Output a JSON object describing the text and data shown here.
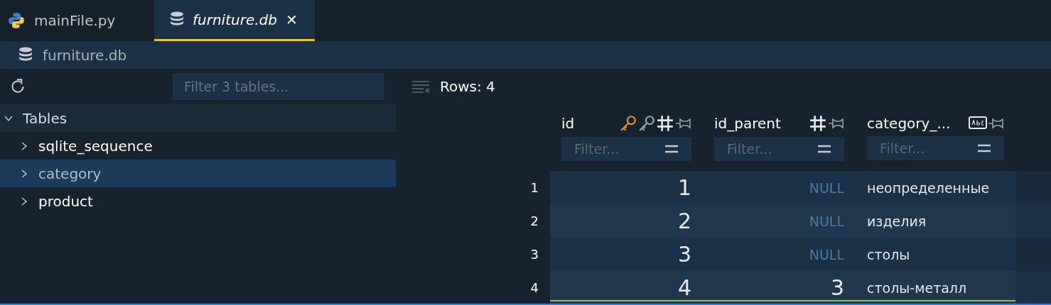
{
  "tabs": [
    {
      "label": "mainFile.py",
      "kind": "python",
      "selected": false,
      "italic": false,
      "closable": false
    },
    {
      "label": "furniture.db",
      "kind": "database",
      "selected": true,
      "italic": true,
      "closable": true
    }
  ],
  "close_glyph": "✕",
  "breadcrumb": "furniture.db",
  "sidebar": {
    "filter_placeholder": "Filter 3 tables...",
    "tree": [
      {
        "label": "Tables",
        "expanded": true,
        "selected": false,
        "children": [
          {
            "label": "sqlite_sequence",
            "expanded": false,
            "selected": false
          },
          {
            "label": "category",
            "expanded": false,
            "selected": true
          },
          {
            "label": "product",
            "expanded": false,
            "selected": false
          }
        ]
      }
    ]
  },
  "grid": {
    "row_count": "Rows: 4",
    "columns": [
      {
        "name": "id",
        "primary_key": true,
        "foreign_key": true,
        "kind": "integer",
        "filter_placeholder": "Filter..."
      },
      {
        "name": "id_parent",
        "primary_key": false,
        "foreign_key": false,
        "kind": "integer",
        "filter_placeholder": "Filter..."
      },
      {
        "name": "category_...",
        "primary_key": false,
        "foreign_key": false,
        "kind": "text",
        "filter_placeholder": "Filter..."
      }
    ],
    "rows": [
      {
        "number": "1",
        "cells": [
          {
            "value": "1",
            "is_null": false
          },
          {
            "value": "NULL",
            "is_null": true
          },
          {
            "value": "неопределенные",
            "is_null": false
          }
        ],
        "editing": false
      },
      {
        "number": "2",
        "cells": [
          {
            "value": "2",
            "is_null": false
          },
          {
            "value": "NULL",
            "is_null": true
          },
          {
            "value": "изделия",
            "is_null": false
          }
        ],
        "editing": false
      },
      {
        "number": "3",
        "cells": [
          {
            "value": "3",
            "is_null": false
          },
          {
            "value": "NULL",
            "is_null": true
          },
          {
            "value": "столы",
            "is_null": false
          }
        ],
        "editing": false
      },
      {
        "number": "4",
        "cells": [
          {
            "value": "4",
            "is_null": false
          },
          {
            "value": "3",
            "is_null": false
          },
          {
            "value": "столы-металл",
            "is_null": false
          }
        ],
        "editing": true
      }
    ]
  }
}
